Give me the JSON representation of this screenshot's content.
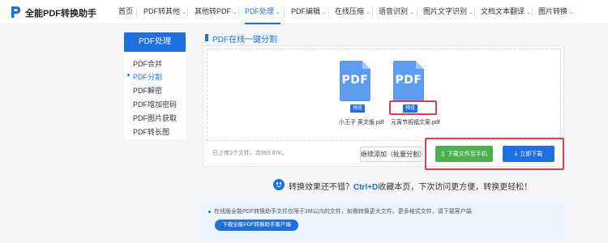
{
  "header": {
    "brand": "全能PDF转换助手",
    "nav": [
      {
        "label": "首页",
        "dropdown": false,
        "active": false
      },
      {
        "label": "PDF转其他",
        "dropdown": true,
        "active": false
      },
      {
        "label": "其他转PDF",
        "dropdown": true,
        "active": false
      },
      {
        "label": "PDF处理",
        "dropdown": true,
        "active": true
      },
      {
        "label": "PDF编辑",
        "dropdown": true,
        "active": false
      },
      {
        "label": "在线压缩",
        "dropdown": true,
        "active": false
      },
      {
        "label": "语音识别",
        "dropdown": true,
        "active": false
      },
      {
        "label": "图片文字识别",
        "dropdown": true,
        "active": false
      },
      {
        "label": "文档文本翻译",
        "dropdown": true,
        "active": false
      },
      {
        "label": "图片转换",
        "dropdown": true,
        "active": false
      }
    ],
    "chevron": "⌄"
  },
  "sidebar": {
    "title": "PDF处理",
    "items": [
      {
        "label": "PDF合并",
        "active": false
      },
      {
        "label": "PDF分割",
        "active": true
      },
      {
        "label": "PDF解密",
        "active": false
      },
      {
        "label": "PDF增加密码",
        "active": false
      },
      {
        "label": "PDF图片获取",
        "active": false
      },
      {
        "label": "PDF转长图",
        "active": false
      }
    ]
  },
  "main": {
    "title": "PDF在线一键分割",
    "files": [
      {
        "icon_text": "PDF",
        "preview": "预览",
        "name": "小王子 英文版.pdf"
      },
      {
        "icon_text": "PDF",
        "preview": "预览",
        "name": "元宵节祝福文案.pdf"
      }
    ],
    "upload_summary": "已上传2个文件，共993.67K。",
    "buttons": {
      "continue": "继续添加（批量分割）",
      "send_phone": "下载文件至手机",
      "download_now": "立即下载"
    }
  },
  "tip": {
    "prefix": "转换效果还不错？",
    "shortcut": "Ctrl+D",
    "suffix": "收藏本页，下次访问更方便，转换更轻松！"
  },
  "notice": {
    "text": "在线版全能PDF转换助手文件仅限于2M以内的文件，如需转换更大文件、更多格式文件，请下载客户端",
    "button": "下载全能PDF转换助手客户端"
  },
  "colors": {
    "accent": "#1e6fe0",
    "green": "#4caf50",
    "highlight": "#e23b4a",
    "file_icon": "#5d9cf0"
  },
  "icons": {
    "phone_icon": "▯",
    "download_icon": "⤓"
  }
}
